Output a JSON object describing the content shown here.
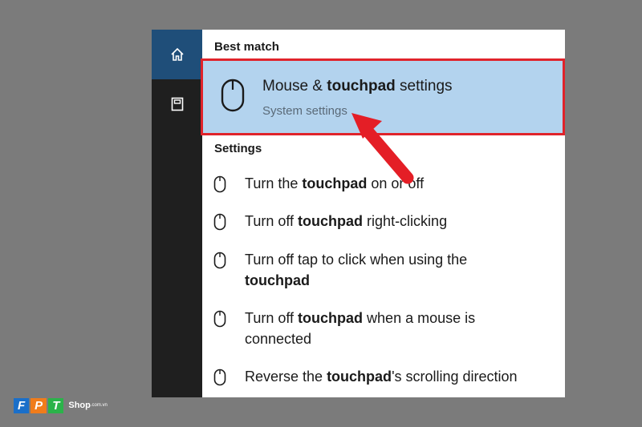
{
  "rail": {
    "items": [
      {
        "icon": "home-icon",
        "active": true
      },
      {
        "icon": "notebook-icon",
        "active": false
      }
    ]
  },
  "best_match": {
    "heading": "Best match",
    "title_pre": "Mouse & ",
    "title_bold": "touchpad",
    "title_post": " settings",
    "subtitle": "System settings",
    "icon": "mouse-icon"
  },
  "settings": {
    "heading": "Settings",
    "items": [
      {
        "pre": "Turn the ",
        "bold": "touchpad",
        "post": " on or off"
      },
      {
        "pre": "Turn off ",
        "bold": "touchpad",
        "post": " right-clicking"
      },
      {
        "pre": "Turn off tap to click when using the ",
        "bold": "touchpad",
        "post": ""
      },
      {
        "pre": "Turn off ",
        "bold": "touchpad",
        "post": " when a mouse is connected"
      },
      {
        "pre": "Reverse the ",
        "bold": "touchpad",
        "post": "'s scrolling direction"
      }
    ]
  },
  "logo": {
    "letters": [
      "F",
      "P",
      "T"
    ],
    "shop": "Shop",
    "domain": ".com.vn"
  },
  "colors": {
    "highlight": "#b3d3ee",
    "border": "#e0232b",
    "rail": "#1f1f1f",
    "rail_active": "#1f4e79"
  }
}
